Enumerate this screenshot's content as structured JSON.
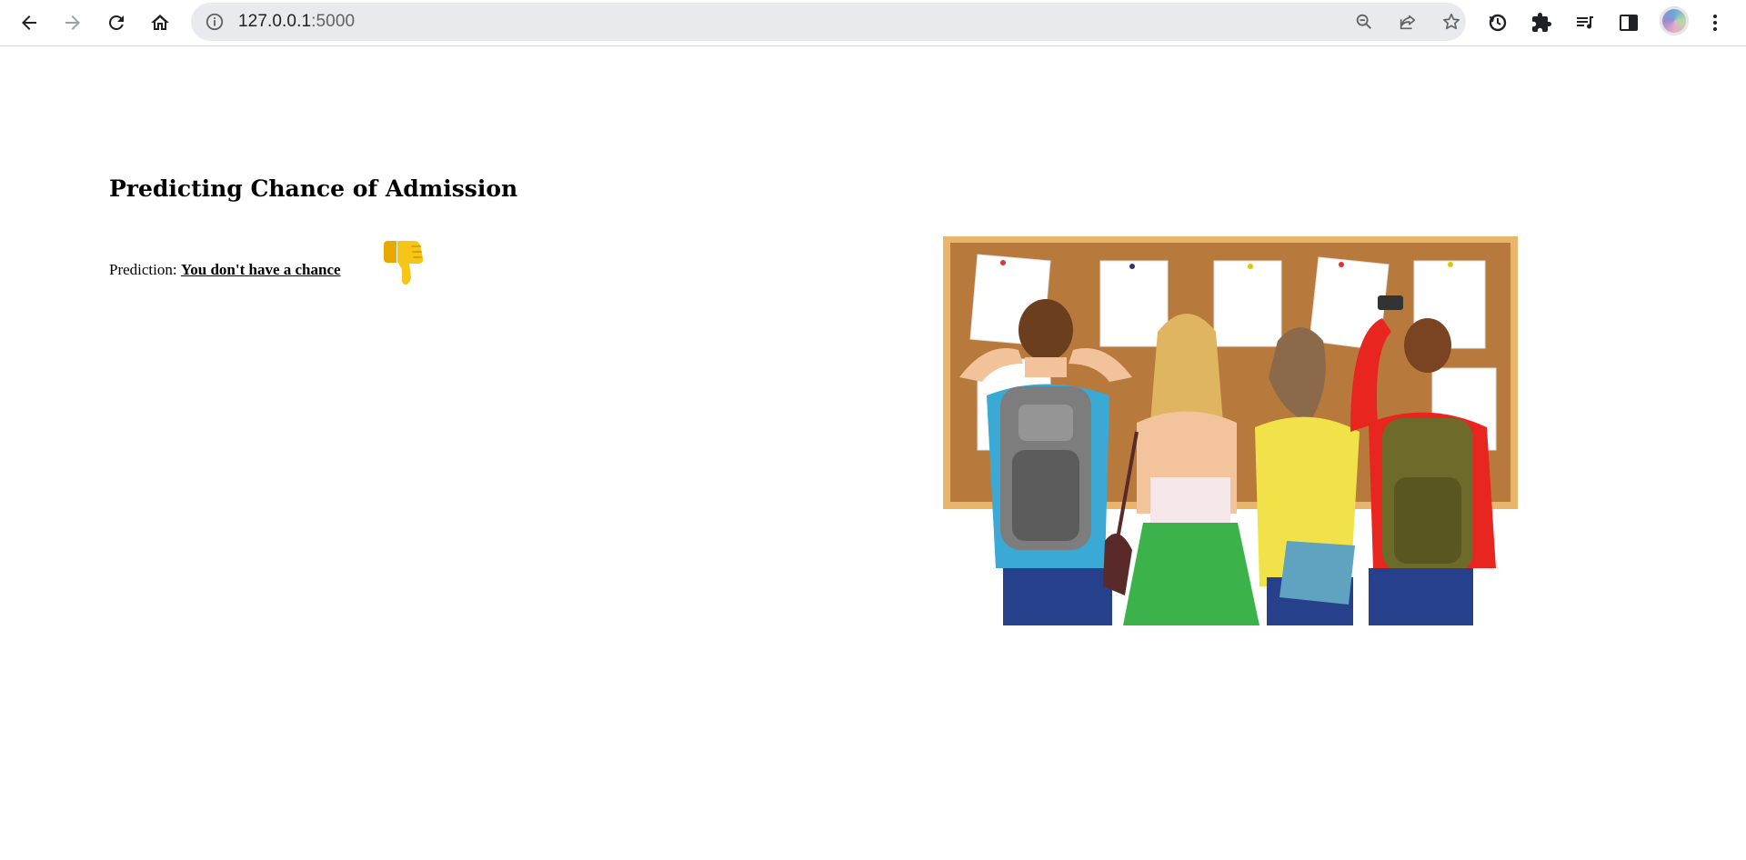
{
  "browser": {
    "url_host": "127.0.0.1",
    "url_port": ":5000",
    "buttons": {
      "back": "back-icon",
      "forward": "forward-icon",
      "reload": "reload-icon",
      "home": "home-icon"
    }
  },
  "page": {
    "title": "Predicting Chance of Admission",
    "prediction_label": "Prediction: ",
    "prediction_value": "You don't have a chance",
    "result_icon": "thumbs-down-icon"
  },
  "colors": {
    "toolbar_bg": "#ffffff",
    "omnibox_bg": "#e8eaed",
    "board": "#b87a3c",
    "board_frame": "#e9b56d",
    "thumbs": "#f5c518"
  }
}
